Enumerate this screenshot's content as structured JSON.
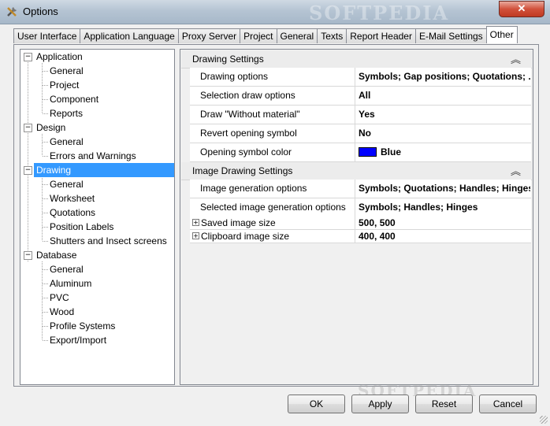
{
  "window": {
    "title": "Options",
    "watermark": "SOFTPEDIA",
    "close_label": "✕"
  },
  "tabs": [
    {
      "label": "User Interface"
    },
    {
      "label": "Application Language"
    },
    {
      "label": "Proxy Server"
    },
    {
      "label": "Project"
    },
    {
      "label": "General"
    },
    {
      "label": "Texts"
    },
    {
      "label": "Report Header"
    },
    {
      "label": "E-Mail Settings"
    },
    {
      "label": "Other",
      "active": true
    }
  ],
  "tree": [
    {
      "label": "Application",
      "level": 0,
      "expanded": true
    },
    {
      "label": "General",
      "level": 1
    },
    {
      "label": "Project",
      "level": 1
    },
    {
      "label": "Component",
      "level": 1
    },
    {
      "label": "Reports",
      "level": 1
    },
    {
      "label": "Design",
      "level": 0,
      "expanded": true
    },
    {
      "label": "General",
      "level": 1
    },
    {
      "label": "Errors and Warnings",
      "level": 1
    },
    {
      "label": "Drawing",
      "level": 0,
      "expanded": true,
      "selected": true
    },
    {
      "label": "General",
      "level": 1
    },
    {
      "label": "Worksheet",
      "level": 1
    },
    {
      "label": "Quotations",
      "level": 1
    },
    {
      "label": "Position Labels",
      "level": 1
    },
    {
      "label": "Shutters and Insect screens",
      "level": 1
    },
    {
      "label": "Database",
      "level": 0,
      "expanded": true
    },
    {
      "label": "General",
      "level": 1
    },
    {
      "label": "Aluminum",
      "level": 1
    },
    {
      "label": "PVC",
      "level": 1
    },
    {
      "label": "Wood",
      "level": 1
    },
    {
      "label": "Profile Systems",
      "level": 1
    },
    {
      "label": "Export/Import",
      "level": 1
    }
  ],
  "drawing_settings": {
    "header": "Drawing Settings",
    "rows": [
      {
        "name": "Drawing options",
        "value": "Symbols; Gap positions; Quotations; ..."
      },
      {
        "name": "Selection draw options",
        "value": "All"
      },
      {
        "name": "Draw \"Without material\"",
        "value": "Yes"
      },
      {
        "name": "Revert opening symbol",
        "value": "No"
      },
      {
        "name": "Opening symbol color",
        "value": "Blue",
        "swatch": "#0000ff"
      }
    ]
  },
  "image_settings": {
    "header": "Image Drawing Settings",
    "rows": [
      {
        "name": "Image generation options",
        "value": "Symbols; Quotations; Handles; Hinges"
      },
      {
        "name": "Selected image generation options",
        "value": "Symbols; Handles; Hinges"
      },
      {
        "name": "Saved image size",
        "value": "500, 500",
        "expandable": true
      },
      {
        "name": "Clipboard image size",
        "value": "400, 400",
        "expandable": true
      }
    ]
  },
  "buttons": {
    "ok": "OK",
    "apply": "Apply",
    "reset": "Reset",
    "cancel": "Cancel"
  }
}
